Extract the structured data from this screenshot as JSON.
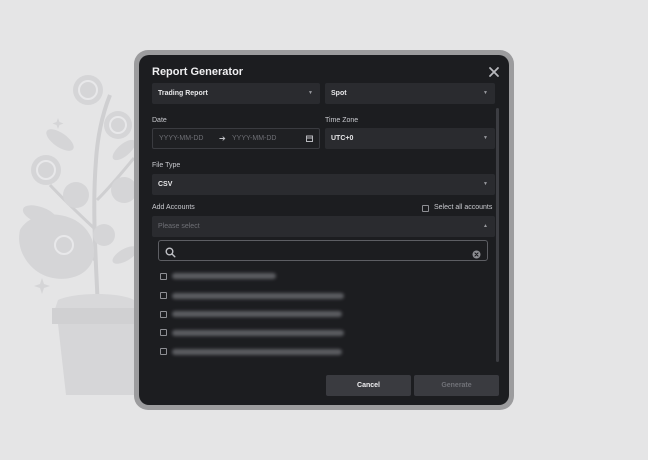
{
  "dialog": {
    "title": "Report Generator",
    "report_type": {
      "value": "Trading Report"
    },
    "market": {
      "value": "Spot"
    },
    "date": {
      "label": "Date",
      "start_placeholder": "YYYY-MM-DD",
      "end_placeholder": "YYYY-MM-DD"
    },
    "time_zone": {
      "label": "Time Zone",
      "value": "UTC+0"
    },
    "file_type": {
      "label": "File Type",
      "value": "CSV"
    },
    "accounts": {
      "label": "Add Accounts",
      "select_all_label": "Select all accounts",
      "placeholder": "Please select",
      "search_placeholder": "",
      "items": [
        {
          "label": ""
        },
        {
          "label": ""
        },
        {
          "label": ""
        },
        {
          "label": ""
        },
        {
          "label": ""
        }
      ]
    },
    "buttons": {
      "cancel": "Cancel",
      "generate": "Generate"
    }
  },
  "icons": {
    "close": "close-icon",
    "calendar": "calendar-icon",
    "search": "search-icon",
    "clear": "clear-icon",
    "arrow": "arrow-right-icon"
  },
  "colors": {
    "page_background": "#e5e5e6",
    "dialog_background": "#1c1d20",
    "field_background": "#2a2b2f",
    "button_background": "#3a3b40"
  }
}
